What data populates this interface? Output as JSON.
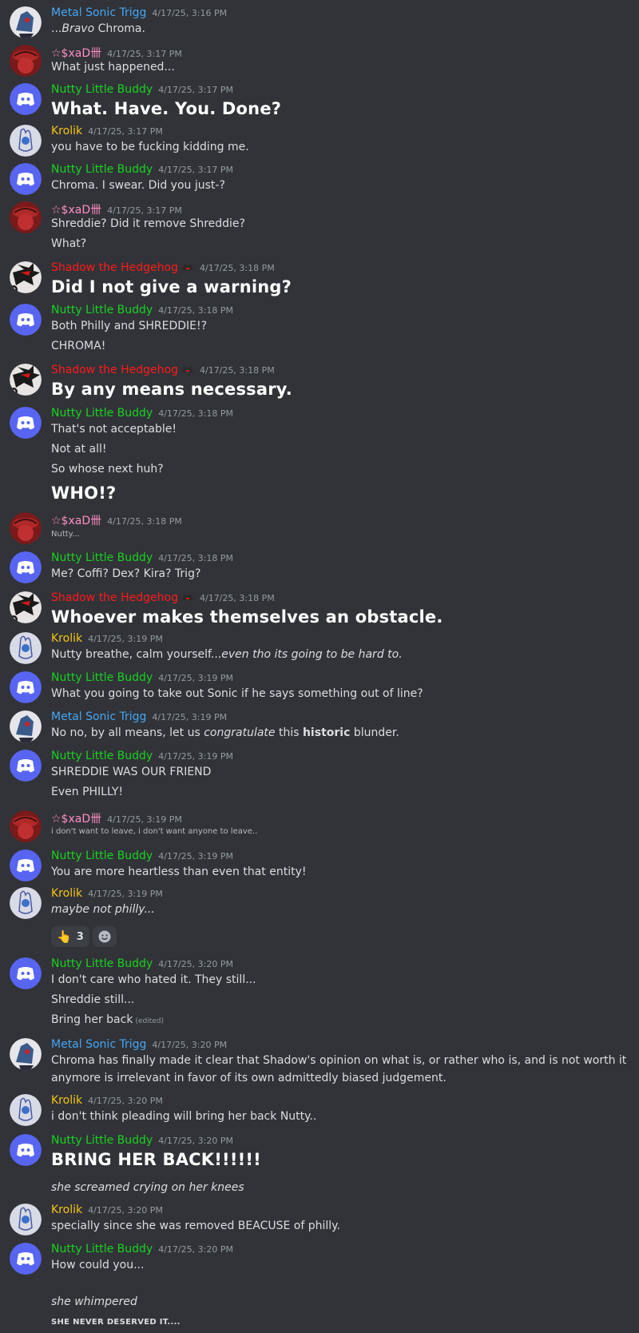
{
  "colors": {
    "background": "#313338",
    "text": "#dbdee1",
    "timestamp": "#949ba4",
    "nutty": "#18d31f",
    "metal": "#46a6f5",
    "krolik": "#f5c518",
    "shadow": "#ff1a1a",
    "sxad": "#ff8fc4"
  },
  "messages": [
    {
      "user": "Metal Sonic Trigg",
      "time": "4/17/25, 3:16 PM",
      "lines": [
        {
          "pre": "...",
          "em": "Bravo",
          "post": " Chroma."
        }
      ]
    },
    {
      "user": "☆$xaD卌",
      "time": "4/17/25, 3:17 PM",
      "lines": [
        {
          "text": "What just happened..."
        }
      ]
    },
    {
      "user": "Nutty Little Buddy",
      "time": "4/17/25, 3:17 PM",
      "lines": [
        {
          "text": "What. Have. You. Done?"
        }
      ]
    },
    {
      "user": "Krolik",
      "time": "4/17/25, 3:17 PM",
      "lines": [
        {
          "text": "you have to be fucking kidding me."
        }
      ]
    },
    {
      "user": "Nutty Little Buddy",
      "time": "4/17/25, 3:17 PM",
      "lines": [
        {
          "text": "Chroma. I swear. Did you just-?"
        }
      ]
    },
    {
      "user": "☆$xaD卌",
      "time": "4/17/25, 3:17 PM",
      "lines": [
        {
          "text": "Shreddie? Did it remove Shreddie?"
        },
        {
          "text": "What?"
        }
      ]
    },
    {
      "user": "Shadow the Hedgehog",
      "time": "4/17/25, 3:18 PM",
      "lines": [
        {
          "text": "Did I not give a warning?"
        }
      ]
    },
    {
      "user": "Nutty Little Buddy",
      "time": "4/17/25, 3:18 PM",
      "lines": [
        {
          "text": "Both Philly and SHREDDIE!?"
        },
        {
          "text": "CHROMA!"
        }
      ]
    },
    {
      "user": "Shadow the Hedgehog",
      "time": "4/17/25, 3:18 PM",
      "lines": [
        {
          "text": "By any means necessary."
        }
      ]
    },
    {
      "user": "Nutty Little Buddy",
      "time": "4/17/25, 3:18 PM",
      "lines": [
        {
          "text": "That's not acceptable!"
        },
        {
          "text": "Not at all!"
        },
        {
          "text": "So whose next huh?"
        },
        {
          "text": "WHO!?"
        }
      ]
    },
    {
      "user": "☆$xaD卌",
      "time": "4/17/25, 3:18 PM",
      "lines": [
        {
          "text": "Nutty..."
        }
      ]
    },
    {
      "user": "Nutty Little Buddy",
      "time": "4/17/25, 3:18 PM",
      "lines": [
        {
          "text": "Me? Coffi? Dex? Kira? Trig?"
        }
      ]
    },
    {
      "user": "Shadow the Hedgehog",
      "time": "4/17/25, 3:18 PM",
      "lines": [
        {
          "text": "Whoever makes themselves an obstacle."
        }
      ]
    },
    {
      "user": "Krolik",
      "time": "4/17/25, 3:19 PM",
      "lines": [
        {
          "pre": "Nutty breathe, calm yourself...",
          "em": "even tho its going to be hard to.",
          "post": ""
        }
      ]
    },
    {
      "user": "Nutty Little Buddy",
      "time": "4/17/25, 3:19 PM",
      "lines": [
        {
          "text": "What you going to take out Sonic if he says something out of line?"
        }
      ]
    },
    {
      "user": "Metal Sonic Trigg",
      "time": "4/17/25, 3:19 PM",
      "lines": [
        {
          "pre": "No no, by all means, let us ",
          "em": "congratulate",
          "mid": " this ",
          "strong": "historic",
          "post": " blunder."
        }
      ]
    },
    {
      "user": "Nutty Little Buddy",
      "time": "4/17/25, 3:19 PM",
      "lines": [
        {
          "text": "SHREDDIE WAS OUR FRIEND"
        },
        {
          "text": "Even PHILLY!"
        }
      ]
    },
    {
      "user": "☆$xaD卌",
      "time": "4/17/25, 3:19 PM",
      "lines": [
        {
          "text": "i don't want to leave, i don't want anyone to leave.."
        }
      ]
    },
    {
      "user": "Nutty Little Buddy",
      "time": "4/17/25, 3:19 PM",
      "lines": [
        {
          "text": "You are more heartless than even that entity!"
        }
      ]
    },
    {
      "user": "Krolik",
      "time": "4/17/25, 3:19 PM",
      "lines": [
        {
          "text": "maybe not philly..."
        }
      ],
      "reaction": {
        "emoji": "👆",
        "count": "3"
      }
    },
    {
      "user": "Nutty Little Buddy",
      "time": "4/17/25, 3:20 PM",
      "lines": [
        {
          "text": "I don't care who hated it. They still..."
        },
        {
          "text": "Shreddie still..."
        },
        {
          "text": "Bring her back",
          "edited": "(edited)"
        }
      ]
    },
    {
      "user": "Metal Sonic Trigg",
      "time": "4/17/25, 3:20 PM",
      "lines": [
        {
          "text": "Chroma has finally made it clear that Shadow's opinion on what is, or rather who is, and is not worth it"
        },
        {
          "text": "anymore is irrelevant in favor of its own admittedly biased judgement."
        }
      ]
    },
    {
      "user": "Krolik",
      "time": "4/17/25, 3:20 PM",
      "lines": [
        {
          "text": "i don't think pleading will bring her back Nutty.."
        }
      ]
    },
    {
      "user": "Nutty Little Buddy",
      "time": "4/17/25, 3:20 PM",
      "lines": [
        {
          "text": "BRING HER BACK!!!!!!"
        },
        {
          "text": "she screamed crying on her knees"
        }
      ]
    },
    {
      "user": "Krolik",
      "time": "4/17/25, 3:20 PM",
      "lines": [
        {
          "text": "specially since she was removed BEACUSE of philly."
        }
      ]
    },
    {
      "user": "Nutty Little Buddy",
      "time": "4/17/25, 3:20 PM",
      "lines": [
        {
          "text": "How could you..."
        },
        {
          "text": "she whimpered"
        },
        {
          "text": "SHE NEVER DESERVED IT...."
        }
      ]
    }
  ]
}
